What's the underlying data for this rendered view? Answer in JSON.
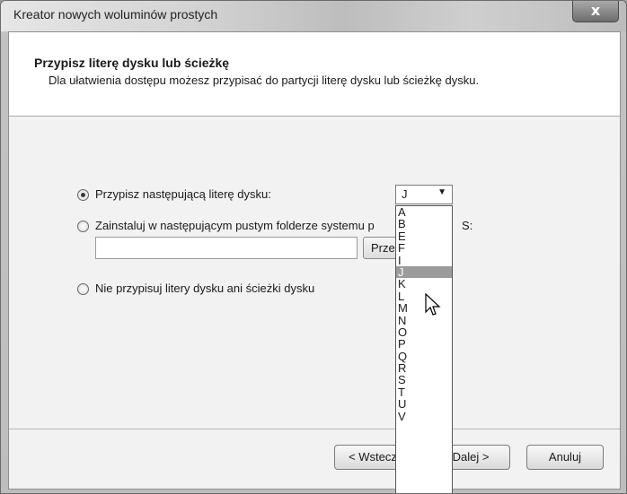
{
  "window": {
    "title": "Kreator nowych woluminów prostych",
    "close_label": "x"
  },
  "header": {
    "title": "Przypisz literę dysku lub ścieżkę",
    "subtitle": "Dla ułatwienia dostępu możesz przypisać do partycji literę dysku lub ścieżkę dysku."
  },
  "options": {
    "assign_letter": {
      "label": "Przypisz następującą literę dysku:",
      "checked": true
    },
    "mount_folder": {
      "label": "Zainstaluj w następującym pustym folderze systemu p",
      "label_tail": "S:",
      "checked": false
    },
    "no_assign": {
      "label": "Nie przypisuj litery dysku ani ścieżki dysku",
      "checked": false
    }
  },
  "letter_select": {
    "value": "J",
    "options": [
      "A",
      "B",
      "E",
      "F",
      "I",
      "J",
      "K",
      "L",
      "M",
      "N",
      "O",
      "P",
      "Q",
      "R",
      "S",
      "T",
      "U",
      "V"
    ],
    "highlighted": "J"
  },
  "folder": {
    "path_value": "",
    "browse_label": "Przeglądaj..."
  },
  "footer": {
    "back_label": "< Wstecz",
    "next_label": "Dalej >",
    "cancel_label": "Anuluj"
  }
}
